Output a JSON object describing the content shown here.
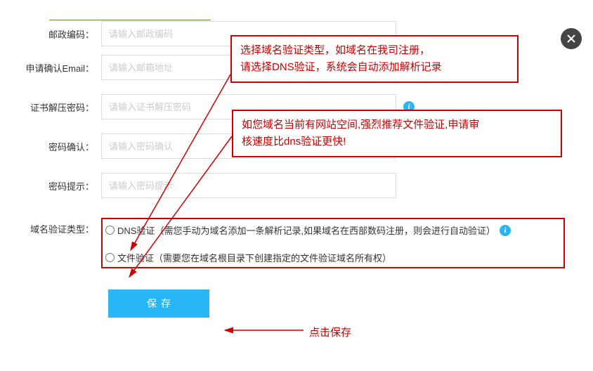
{
  "fields": {
    "postal_code": {
      "label": "邮政编码：",
      "placeholder": "请输入邮政编码"
    },
    "email": {
      "label": "申请确认Email：",
      "placeholder": "请输入邮箱地址"
    },
    "cert_password": {
      "label": "证书解压密码：",
      "placeholder": "请输入证书解压密码"
    },
    "password_confirm": {
      "label": "密码确认：",
      "placeholder": "请输入密码确认"
    },
    "password_hint": {
      "label": "密码提示：",
      "placeholder": "请输入密码提示"
    },
    "domain_verify_type": {
      "label": "域名验证类型："
    }
  },
  "radio_options": {
    "dns": "DNS验证（需您手动为域名添加一条解析记录,如果域名在西部数码注册，则会进行自动验证）",
    "file": "文件验证（需要您在域名根目录下创建指定的文件验证域名所有权）"
  },
  "save_button": "保存",
  "annotations": {
    "a1_line1": "选择域名验证类型，如域名在我司注册，",
    "a1_line2": "请选择DNS验证，系统会自动添加解析记录",
    "a2_line1": "如您域名当前有网站空间,强烈推荐文件验证,申请审",
    "a2_line2": "核速度比dns验证更快!",
    "save_hint": "点击保存"
  },
  "colors": {
    "accent": "#29b6f6",
    "annotation": "#c00"
  }
}
